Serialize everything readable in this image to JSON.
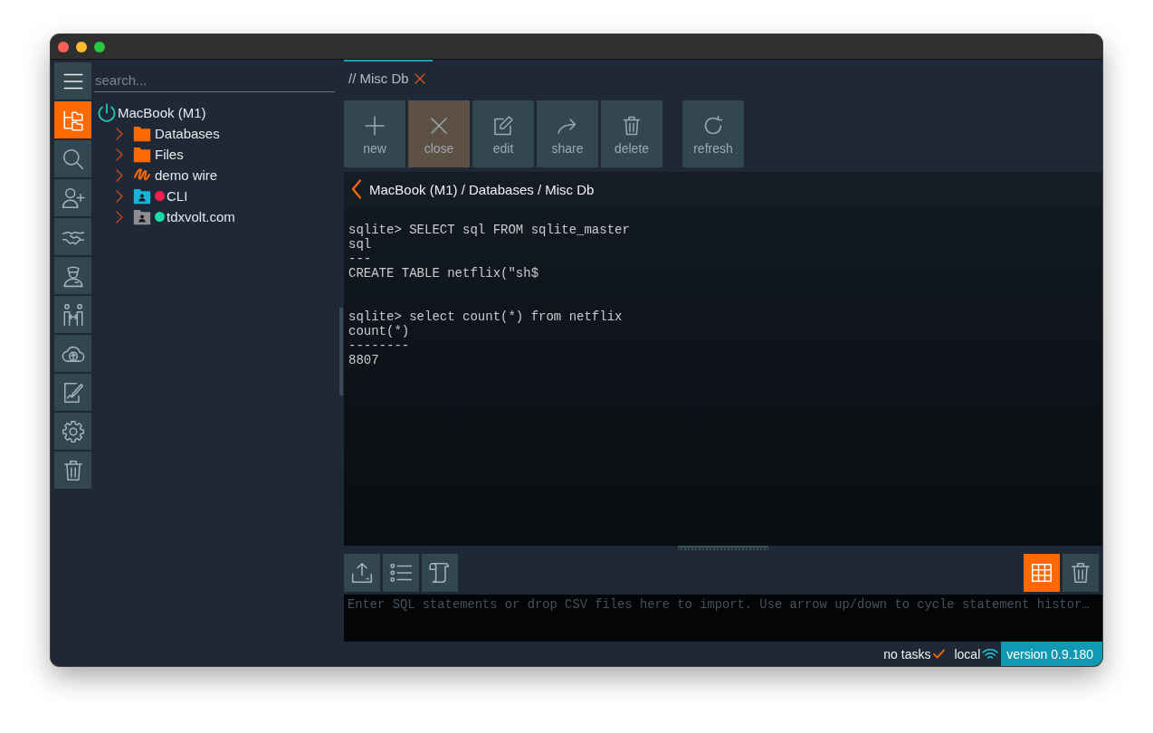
{
  "rail": [
    {
      "kind": "menu",
      "selected": false
    },
    {
      "kind": "tree",
      "selected": true
    },
    {
      "kind": "search",
      "selected": false
    },
    {
      "kind": "add-user",
      "selected": false
    },
    {
      "kind": "handshake",
      "selected": false
    },
    {
      "kind": "officer",
      "selected": false
    },
    {
      "kind": "exchange",
      "selected": false
    },
    {
      "kind": "cloud-upload",
      "selected": false
    },
    {
      "kind": "sign",
      "selected": false
    },
    {
      "kind": "settings",
      "selected": false
    },
    {
      "kind": "trash",
      "selected": false
    }
  ],
  "explorer": {
    "search": {
      "placeholder": "search..."
    },
    "tree": [
      {
        "label": "MacBook (M1)",
        "kind": "device",
        "children": [
          {
            "label": "Databases",
            "kind": "folder",
            "expanded": false
          },
          {
            "label": "Files",
            "kind": "folder",
            "expanded": false
          },
          {
            "label": "demo wire",
            "kind": "wire",
            "expanded": false
          },
          {
            "label": "CLI",
            "kind": "contact-folder",
            "color": "#17b3d8",
            "expanded": false,
            "status": {
              "color": "#f41f4f"
            }
          },
          {
            "label": "tdxvolt.com",
            "kind": "contact-folder",
            "color": "#8e8e8e",
            "expanded": false,
            "status": {
              "color": "#1fd8a8"
            }
          }
        ]
      }
    ]
  },
  "tabs": [
    {
      "label": "// Misc Db",
      "selected": true,
      "closable": true
    }
  ],
  "toolbar": {
    "groups": [
      [
        {
          "label": "new",
          "kind": "plus",
          "highlighted": false
        },
        {
          "label": "close",
          "kind": "close",
          "highlighted": true
        },
        {
          "label": "edit",
          "kind": "edit",
          "highlighted": false
        },
        {
          "label": "share",
          "kind": "share",
          "highlighted": false
        },
        {
          "label": "delete",
          "kind": "trash",
          "highlighted": false
        }
      ],
      [
        {
          "label": "refresh",
          "kind": "refresh",
          "highlighted": false
        }
      ]
    ]
  },
  "breadcrumb": {
    "path": "MacBook (M1) / Databases / Misc Db"
  },
  "console": {
    "blocks": [
      {
        "lines": [
          "sqlite> SELECT sql FROM sqlite_master",
          "sql",
          "---",
          "CREATE TABLE netflix(\"sh$"
        ]
      },
      {
        "lines": [
          "sqlite> select count(*) from netflix",
          "count(*)",
          "--------",
          "8807"
        ]
      }
    ]
  },
  "query_bar": {
    "tools": [
      {
        "kind": "export"
      },
      {
        "kind": "list"
      },
      {
        "kind": "script"
      }
    ],
    "right_tools": [
      {
        "kind": "grid",
        "on": true
      },
      {
        "kind": "trash",
        "on": false
      }
    ],
    "input": {
      "placeholder": "Enter SQL statements or drop CSV files here to import. Use arrow up/down to cycle statement histor…"
    }
  },
  "status_bar": {
    "tasks": "no tasks",
    "tasks_done": true,
    "connection": "local",
    "online": true,
    "version": "version 0.9.180"
  }
}
